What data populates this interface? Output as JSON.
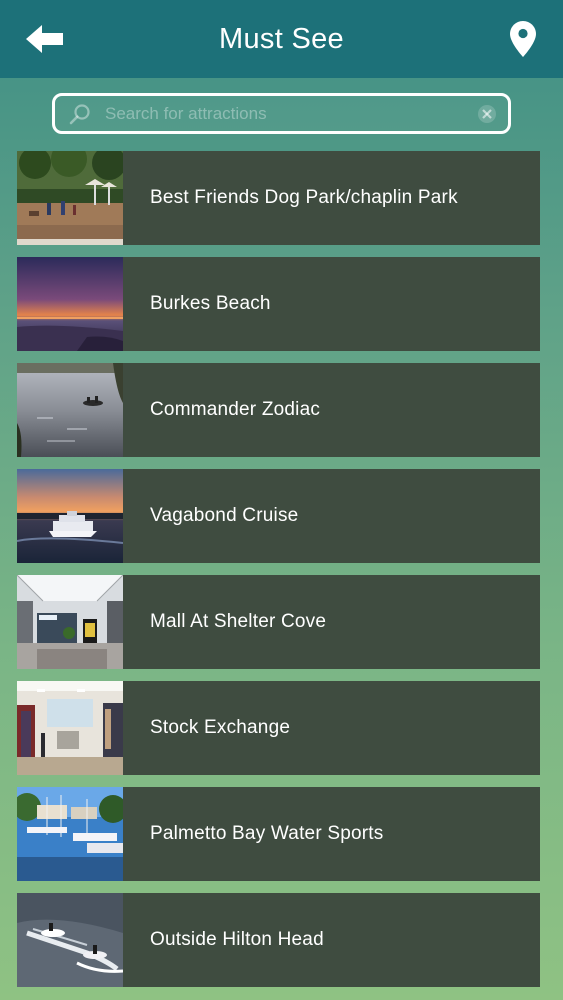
{
  "header": {
    "title": "Must See",
    "back_icon": "arrow-left-icon",
    "map_icon": "map-pin-icon",
    "bar_color": "#1d7179"
  },
  "search": {
    "placeholder": "Search for attractions",
    "value": "",
    "icon": "search-icon",
    "clear_icon": "clear-icon"
  },
  "attractions": [
    {
      "name": "Best Friends Dog Park/chaplin Park",
      "thumbnail": "park-photo"
    },
    {
      "name": "Burkes Beach",
      "thumbnail": "sunset-beach-photo"
    },
    {
      "name": "Commander Zodiac",
      "thumbnail": "boat-on-water-photo"
    },
    {
      "name": "Vagabond Cruise",
      "thumbnail": "cruise-boat-sunset-photo"
    },
    {
      "name": "Mall At Shelter Cove",
      "thumbnail": "mall-interior-photo"
    },
    {
      "name": "Stock Exchange",
      "thumbnail": "clothing-store-photo"
    },
    {
      "name": "Palmetto Bay Water Sports",
      "thumbnail": "marina-photo"
    },
    {
      "name": "Outside Hilton Head",
      "thumbnail": "jet-ski-photo"
    }
  ],
  "colors": {
    "item_background": "#3f4c40",
    "text": "#ffffff"
  }
}
